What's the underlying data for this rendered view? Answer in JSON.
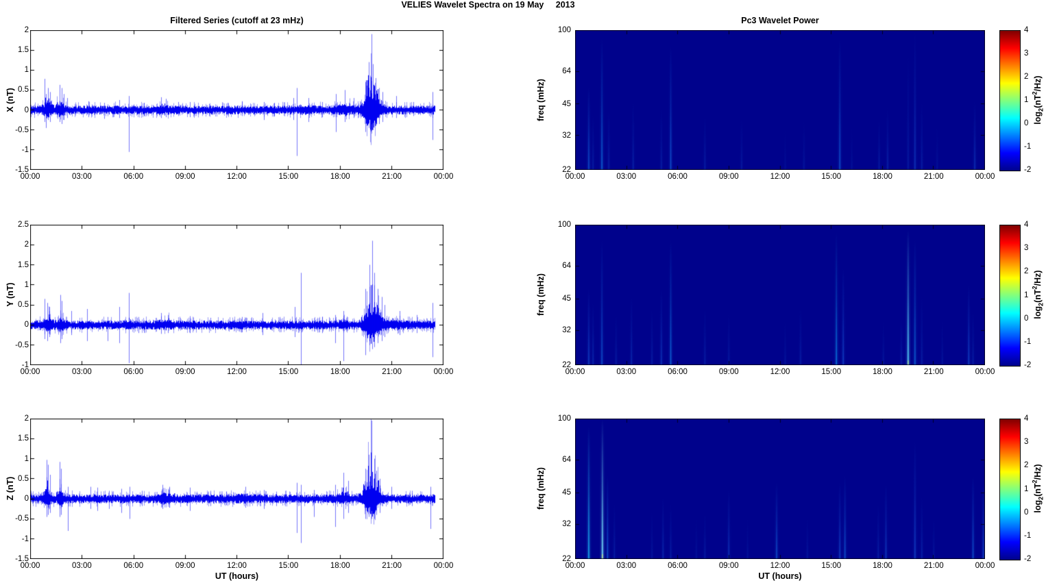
{
  "figure": {
    "title": "VELIES Wavelet Spectra on 19 May     2013"
  },
  "colorbar": {
    "label_parts": {
      "prefix": "log",
      "sub": "2",
      "mid": "(nT",
      "sup": "2",
      "suffix": "/Hz)"
    },
    "ticks": [
      "4",
      "3",
      "2",
      "1",
      "0",
      "-1",
      "-2"
    ],
    "range": [
      -2,
      4
    ],
    "jet_stops": [
      "#00028c",
      "#0000ff",
      "#00ffff",
      "#ffff00",
      "#ff0000",
      "#7f0000"
    ],
    "jet_fracs": [
      0,
      0.125,
      0.375,
      0.625,
      0.875,
      1
    ]
  },
  "chart_data": [
    {
      "type": "line",
      "title": "Filtered Series (cutoff at 23 mHz)",
      "ylabel": "X (nT)",
      "ylim": [
        -1.5,
        2
      ],
      "yticks": [
        "2",
        "1.5",
        "1",
        "0.5",
        "0",
        "-0.5",
        "-1",
        "-1.5"
      ],
      "xticks": [
        "00:00",
        "03:00",
        "06:00",
        "09:00",
        "12:00",
        "15:00",
        "18:00",
        "21:00",
        "00:00"
      ],
      "xrange_hours": [
        0,
        24
      ],
      "t_end_hours": 23.55,
      "line_color": "#0000f0",
      "noise_base": 0.075,
      "bursts": [
        [
          19.85,
          0.3,
          1.45
        ],
        [
          1.0,
          0.18,
          0.35
        ],
        [
          1.75,
          0.15,
          0.3
        ],
        [
          7.75,
          0.25,
          0.12
        ],
        [
          18.3,
          0.25,
          0.15
        ],
        [
          16.0,
          0.3,
          0.08
        ]
      ],
      "spikes": [
        [
          0.82,
          0.78,
          0.3
        ],
        [
          0.9,
          0.4,
          0.45
        ],
        [
          1.05,
          0.55,
          0.25
        ],
        [
          1.15,
          0.45,
          0.3
        ],
        [
          1.7,
          0.63,
          0.3
        ],
        [
          1.82,
          0.55,
          0.35
        ],
        [
          1.95,
          0.4,
          0.25
        ],
        [
          2.15,
          0.3,
          0.2
        ],
        [
          3.4,
          0.22,
          0.18
        ],
        [
          4.3,
          0.18,
          0.22
        ],
        [
          5.2,
          0.25,
          0.2
        ],
        [
          5.75,
          0.35,
          1.05
        ],
        [
          6.6,
          0.18,
          0.15
        ],
        [
          7.6,
          0.32,
          0.2
        ],
        [
          7.9,
          0.28,
          0.18
        ],
        [
          8.6,
          0.2,
          0.15
        ],
        [
          9.3,
          0.2,
          0.18
        ],
        [
          10.4,
          0.15,
          0.15
        ],
        [
          11.5,
          0.18,
          0.14
        ],
        [
          12.3,
          0.22,
          0.15
        ],
        [
          13.6,
          0.2,
          0.25
        ],
        [
          14.2,
          0.18,
          0.15
        ],
        [
          15.3,
          0.3,
          0.25
        ],
        [
          15.5,
          0.55,
          1.15
        ],
        [
          16.2,
          0.3,
          0.3
        ],
        [
          17.0,
          0.2,
          0.18
        ],
        [
          17.8,
          0.4,
          0.55
        ],
        [
          18.3,
          0.5,
          0.3
        ],
        [
          18.8,
          0.3,
          0.2
        ],
        [
          19.5,
          0.7,
          0.55
        ],
        [
          19.7,
          1.2,
          0.45
        ],
        [
          19.85,
          1.9,
          0.5
        ],
        [
          19.95,
          1.15,
          0.5
        ],
        [
          20.1,
          0.8,
          0.4
        ],
        [
          20.3,
          0.55,
          0.35
        ],
        [
          20.5,
          0.45,
          0.3
        ],
        [
          21.3,
          0.35,
          0.2
        ],
        [
          22.3,
          0.2,
          0.15
        ],
        [
          23.4,
          0.45,
          0.75
        ]
      ]
    },
    {
      "type": "line",
      "ylabel": "Y (nT)",
      "ylim": [
        -1,
        2.5
      ],
      "yticks": [
        "2.5",
        "2",
        "1.5",
        "1",
        "0.5",
        "0",
        "-0.5",
        "-1"
      ],
      "xticks": [
        "00:00",
        "03:00",
        "06:00",
        "09:00",
        "12:00",
        "15:00",
        "18:00",
        "21:00",
        "00:00"
      ],
      "xrange_hours": [
        0,
        24
      ],
      "t_end_hours": 23.55,
      "line_color": "#0000f0",
      "noise_base": 0.075,
      "bursts": [
        [
          19.9,
          0.3,
          1.3
        ],
        [
          1.0,
          0.2,
          0.3
        ],
        [
          1.8,
          0.15,
          0.3
        ],
        [
          7.8,
          0.3,
          0.12
        ],
        [
          5.75,
          0.1,
          0.2
        ],
        [
          18.2,
          0.2,
          0.12
        ],
        [
          21.0,
          0.5,
          0.08
        ]
      ],
      "spikes": [
        [
          0.85,
          0.65,
          0.35
        ],
        [
          1.0,
          0.55,
          0.4
        ],
        [
          1.1,
          0.45,
          0.3
        ],
        [
          1.75,
          0.75,
          0.45
        ],
        [
          1.85,
          0.6,
          0.35
        ],
        [
          2.4,
          0.35,
          0.25
        ],
        [
          3.3,
          0.4,
          0.4
        ],
        [
          4.5,
          0.2,
          0.4
        ],
        [
          5.2,
          0.45,
          0.45
        ],
        [
          5.75,
          0.8,
          0.95
        ],
        [
          6.3,
          0.2,
          0.2
        ],
        [
          7.6,
          0.3,
          0.22
        ],
        [
          8.0,
          0.25,
          0.2
        ],
        [
          9.3,
          0.22,
          0.2
        ],
        [
          10.5,
          0.18,
          0.15
        ],
        [
          12.3,
          0.2,
          0.18
        ],
        [
          13.5,
          0.3,
          0.25
        ],
        [
          14.5,
          0.2,
          0.18
        ],
        [
          15.4,
          0.45,
          0.3
        ],
        [
          15.75,
          1.3,
          1.0
        ],
        [
          17.0,
          0.2,
          0.2
        ],
        [
          17.75,
          0.25,
          0.45
        ],
        [
          18.2,
          0.35,
          0.9
        ],
        [
          19.5,
          0.9,
          0.75
        ],
        [
          19.75,
          1.5,
          0.5
        ],
        [
          19.9,
          2.1,
          0.6
        ],
        [
          20.0,
          1.3,
          0.55
        ],
        [
          20.2,
          0.9,
          0.45
        ],
        [
          20.45,
          0.7,
          0.4
        ],
        [
          20.6,
          0.5,
          0.3
        ],
        [
          21.5,
          0.35,
          0.25
        ],
        [
          22.5,
          0.25,
          0.2
        ],
        [
          23.4,
          0.55,
          0.8
        ]
      ]
    },
    {
      "type": "line",
      "ylabel": "Z (nT)",
      "xlabel": "UT (hours)",
      "ylim": [
        -1.5,
        2
      ],
      "yticks": [
        "2",
        "1.5",
        "1",
        "0.5",
        "0",
        "-0.5",
        "-1",
        "-1.5"
      ],
      "xticks": [
        "00:00",
        "03:00",
        "06:00",
        "09:00",
        "12:00",
        "15:00",
        "18:00",
        "21:00",
        "00:00"
      ],
      "xrange_hours": [
        0,
        24
      ],
      "t_end_hours": 23.55,
      "line_color": "#0000f0",
      "noise_base": 0.075,
      "bursts": [
        [
          19.85,
          0.28,
          1.35
        ],
        [
          1.0,
          0.15,
          0.5
        ],
        [
          1.75,
          0.13,
          0.45
        ],
        [
          7.9,
          0.3,
          0.15
        ],
        [
          18.25,
          0.2,
          0.2
        ],
        [
          12.5,
          0.4,
          0.06
        ]
      ],
      "spikes": [
        [
          0.95,
          0.97,
          0.45
        ],
        [
          1.05,
          0.85,
          0.4
        ],
        [
          1.15,
          0.6,
          0.35
        ],
        [
          1.7,
          0.92,
          0.45
        ],
        [
          1.8,
          0.75,
          0.4
        ],
        [
          2.2,
          0.3,
          0.8
        ],
        [
          3.5,
          0.3,
          0.25
        ],
        [
          3.9,
          0.28,
          0.3
        ],
        [
          4.6,
          0.2,
          0.25
        ],
        [
          5.3,
          0.25,
          0.35
        ],
        [
          5.8,
          0.3,
          0.5
        ],
        [
          6.5,
          0.2,
          0.18
        ],
        [
          7.7,
          0.35,
          0.25
        ],
        [
          8.1,
          0.3,
          0.22
        ],
        [
          9.3,
          0.28,
          0.3
        ],
        [
          10.5,
          0.2,
          0.18
        ],
        [
          11.4,
          0.18,
          0.16
        ],
        [
          12.5,
          0.3,
          0.22
        ],
        [
          13.6,
          0.22,
          0.25
        ],
        [
          14.3,
          0.18,
          0.18
        ],
        [
          15.5,
          0.4,
          0.85
        ],
        [
          15.75,
          0.35,
          1.1
        ],
        [
          16.5,
          0.22,
          0.45
        ],
        [
          17.75,
          0.35,
          0.7
        ],
        [
          18.2,
          0.65,
          0.5
        ],
        [
          18.5,
          0.45,
          0.35
        ],
        [
          19.5,
          0.75,
          0.5
        ],
        [
          19.7,
          1.1,
          0.45
        ],
        [
          19.85,
          1.95,
          0.5
        ],
        [
          20.0,
          1.0,
          0.5
        ],
        [
          20.15,
          0.7,
          0.4
        ],
        [
          20.35,
          0.5,
          0.35
        ],
        [
          21.0,
          0.3,
          0.25
        ],
        [
          22.2,
          0.2,
          0.18
        ],
        [
          23.3,
          0.3,
          0.75
        ]
      ]
    },
    {
      "type": "heatmap",
      "title": "Pc3 Wavelet Power",
      "ylabel": "freq (mHz)",
      "yscale": "log",
      "ylim_mHz": [
        22,
        100
      ],
      "yticks": [
        {
          "label": "100",
          "frac": 0
        },
        {
          "label": "64",
          "frac": 0.295
        },
        {
          "label": "45",
          "frac": 0.528
        },
        {
          "label": "32",
          "frac": 0.7525
        },
        {
          "label": "22",
          "frac": 1
        }
      ],
      "xticks": [
        "00:00",
        "03:00",
        "06:00",
        "09:00",
        "12:00",
        "15:00",
        "18:00",
        "21:00",
        "00:00"
      ],
      "colormap": "jet",
      "clim": [
        -2,
        4
      ],
      "bg": "#00028c",
      "streaks": [
        [
          0.8,
          0.5,
          0.6
        ],
        [
          1.05,
          0.3,
          0.4
        ],
        [
          1.57,
          0.55,
          0.95
        ],
        [
          1.97,
          0.3,
          0.45
        ],
        [
          3.4,
          0.32,
          0.5
        ],
        [
          5.05,
          0.3,
          0.45
        ],
        [
          5.6,
          0.5,
          0.9
        ],
        [
          7.6,
          0.3,
          0.4
        ],
        [
          9.75,
          0.28,
          0.38
        ],
        [
          12.3,
          0.2,
          0.3
        ],
        [
          13.4,
          0.25,
          0.35
        ],
        [
          15.5,
          0.5,
          0.95
        ],
        [
          16.2,
          0.22,
          0.3
        ],
        [
          17.8,
          0.28,
          0.38
        ],
        [
          18.3,
          0.32,
          0.45
        ],
        [
          19.5,
          0.28,
          0.85
        ],
        [
          19.9,
          0.4,
          1.0
        ],
        [
          20.3,
          0.3,
          0.5
        ],
        [
          21.2,
          0.22,
          0.32
        ],
        [
          23.4,
          0.38,
          0.5
        ]
      ]
    },
    {
      "type": "heatmap",
      "ylabel": "freq (mHz)",
      "yscale": "log",
      "ylim_mHz": [
        22,
        100
      ],
      "yticks": [
        {
          "label": "100",
          "frac": 0
        },
        {
          "label": "64",
          "frac": 0.295
        },
        {
          "label": "45",
          "frac": 0.528
        },
        {
          "label": "32",
          "frac": 0.7525
        },
        {
          "label": "22",
          "frac": 1
        }
      ],
      "xticks": [
        "00:00",
        "03:00",
        "06:00",
        "09:00",
        "12:00",
        "15:00",
        "18:00",
        "21:00",
        "00:00"
      ],
      "colormap": "jet",
      "clim": [
        -2,
        4
      ],
      "bg": "#00028c",
      "streaks": [
        [
          0.8,
          0.45,
          0.55
        ],
        [
          1.05,
          0.35,
          0.45
        ],
        [
          1.57,
          0.5,
          0.9
        ],
        [
          2.4,
          0.28,
          0.38
        ],
        [
          3.3,
          0.35,
          0.5
        ],
        [
          4.5,
          0.3,
          0.4
        ],
        [
          5.05,
          0.4,
          0.55
        ],
        [
          5.6,
          0.55,
          0.9
        ],
        [
          7.6,
          0.3,
          0.42
        ],
        [
          9.0,
          0.28,
          0.38
        ],
        [
          12.3,
          0.24,
          0.33
        ],
        [
          13.2,
          0.3,
          0.42
        ],
        [
          15.3,
          0.6,
          0.95
        ],
        [
          15.7,
          0.45,
          0.7
        ],
        [
          18.05,
          0.25,
          0.32
        ],
        [
          19.1,
          0.28,
          0.35
        ],
        [
          19.5,
          0.85,
          0.97
        ],
        [
          19.9,
          0.55,
          0.9
        ],
        [
          20.3,
          0.3,
          0.5
        ],
        [
          21.5,
          0.24,
          0.33
        ],
        [
          23.05,
          0.45,
          0.58
        ],
        [
          23.3,
          0.3,
          0.4
        ]
      ]
    },
    {
      "type": "heatmap",
      "ylabel": "freq (mHz)",
      "xlabel": "UT (hours)",
      "yscale": "log",
      "ylim_mHz": [
        22,
        100
      ],
      "yticks": [
        {
          "label": "100",
          "frac": 0
        },
        {
          "label": "64",
          "frac": 0.295
        },
        {
          "label": "45",
          "frac": 0.528
        },
        {
          "label": "32",
          "frac": 0.7525
        },
        {
          "label": "22",
          "frac": 1
        }
      ],
      "xticks": [
        "00:00",
        "03:00",
        "06:00",
        "09:00",
        "12:00",
        "15:00",
        "18:00",
        "21:00",
        "00:00"
      ],
      "colormap": "jet",
      "clim": [
        -2,
        4
      ],
      "bg": "#00028c",
      "streaks": [
        [
          0.8,
          0.75,
          0.95
        ],
        [
          1.6,
          0.9,
          1.0
        ],
        [
          1.9,
          0.5,
          0.6
        ],
        [
          2.3,
          0.3,
          0.4
        ],
        [
          4.5,
          0.25,
          0.35
        ],
        [
          5.15,
          0.35,
          0.45
        ],
        [
          5.6,
          0.3,
          0.4
        ],
        [
          7.1,
          0.22,
          0.3
        ],
        [
          7.6,
          0.28,
          0.35
        ],
        [
          9.0,
          0.4,
          0.5
        ],
        [
          10.1,
          0.22,
          0.3
        ],
        [
          11.8,
          0.5,
          0.55
        ],
        [
          13.6,
          0.25,
          0.3
        ],
        [
          15.5,
          0.45,
          0.55
        ],
        [
          15.8,
          0.5,
          0.6
        ],
        [
          17.75,
          0.3,
          0.4
        ],
        [
          18.2,
          0.42,
          0.55
        ],
        [
          19.9,
          0.45,
          0.85
        ],
        [
          20.3,
          0.32,
          0.45
        ],
        [
          21.0,
          0.25,
          0.3
        ],
        [
          23.3,
          0.5,
          0.6
        ],
        [
          23.9,
          0.45,
          0.55
        ]
      ]
    }
  ]
}
